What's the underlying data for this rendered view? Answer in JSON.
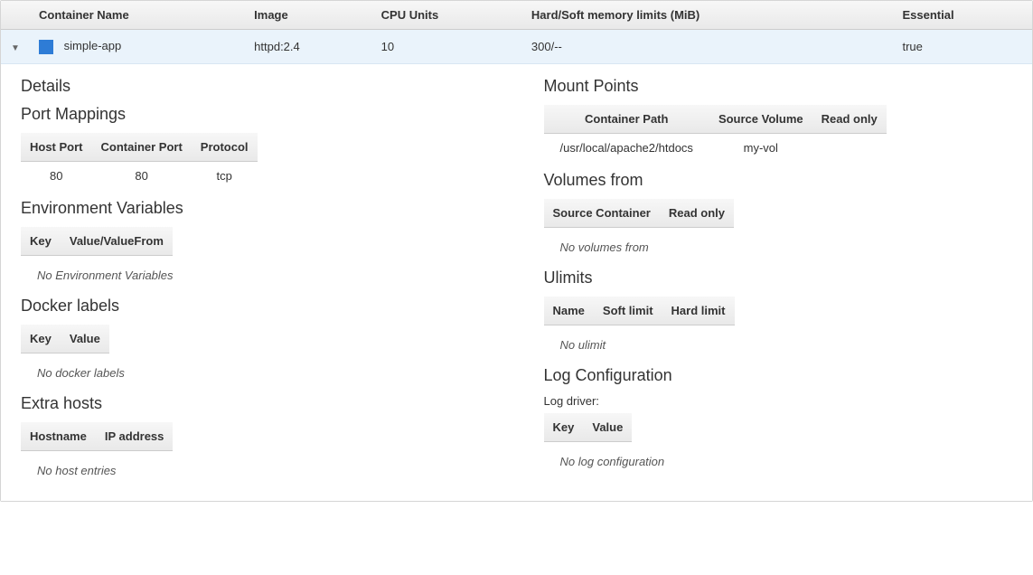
{
  "headers": {
    "container_name": "Container Name",
    "image": "Image",
    "cpu_units": "CPU Units",
    "memory": "Hard/Soft memory limits (MiB)",
    "essential": "Essential"
  },
  "row": {
    "name": "simple-app",
    "image": "httpd:2.4",
    "cpu": "10",
    "memory": "300/--",
    "essential": "true"
  },
  "sections": {
    "details": "Details",
    "port_mappings": "Port Mappings",
    "env_vars": "Environment Variables",
    "docker_labels": "Docker labels",
    "extra_hosts": "Extra hosts",
    "mount_points": "Mount Points",
    "volumes_from": "Volumes from",
    "ulimits": "Ulimits",
    "log_config": "Log Configuration"
  },
  "port_mappings": {
    "h_host": "Host Port",
    "h_container": "Container Port",
    "h_protocol": "Protocol",
    "rows": [
      {
        "host": "80",
        "container": "80",
        "protocol": "tcp"
      }
    ]
  },
  "env_vars": {
    "h_key": "Key",
    "h_value": "Value/ValueFrom",
    "empty": "No Environment Variables"
  },
  "docker_labels": {
    "h_key": "Key",
    "h_value": "Value",
    "empty": "No docker labels"
  },
  "extra_hosts": {
    "h_hostname": "Hostname",
    "h_ip": "IP address",
    "empty": "No host entries"
  },
  "mount_points": {
    "h_path": "Container Path",
    "h_source": "Source Volume",
    "h_readonly": "Read only",
    "rows": [
      {
        "path": "/usr/local/apache2/htdocs",
        "source": "my-vol",
        "readonly": ""
      }
    ]
  },
  "volumes_from": {
    "h_source": "Source Container",
    "h_readonly": "Read only",
    "empty": "No volumes from"
  },
  "ulimits": {
    "h_name": "Name",
    "h_soft": "Soft limit",
    "h_hard": "Hard limit",
    "empty": "No ulimit"
  },
  "log_config": {
    "driver_label": "Log driver:",
    "h_key": "Key",
    "h_value": "Value",
    "empty": "No log configuration"
  }
}
